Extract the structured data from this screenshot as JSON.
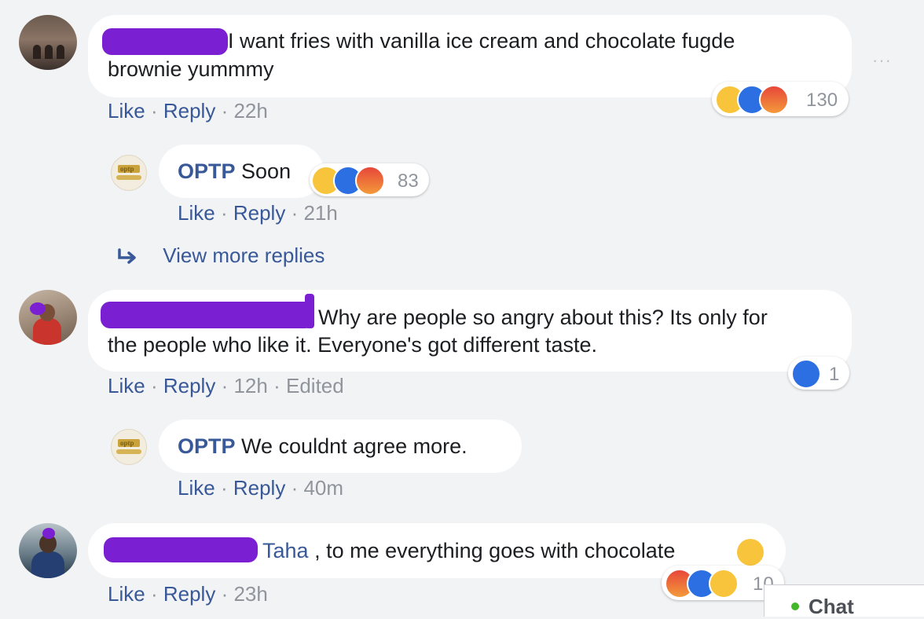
{
  "comments": [
    {
      "text": "I want fries with vanilla ice cream and chocolate fugde",
      "text2": "brownie yummmy",
      "actions": {
        "like": "Like",
        "reply": "Reply",
        "time": "22h"
      },
      "reactions": {
        "icons": [
          "haha-icon",
          "like-icon",
          "angry-icon"
        ],
        "count": "130"
      }
    },
    {
      "text": "Why are people so angry about this? Its only for",
      "text2": "the people who like it. Everyone's got different taste.",
      "actions": {
        "like": "Like",
        "reply": "Reply",
        "time": "12h",
        "edited": "Edited"
      },
      "reactions": {
        "icons": [
          "like-icon"
        ],
        "count": "1"
      }
    },
    {
      "mention": "Taha",
      "text": ", to me everything goes with chocolate",
      "actions": {
        "like": "Like",
        "reply": "Reply",
        "time": "23h"
      },
      "reactions": {
        "icons": [
          "angry-icon",
          "like-icon",
          "haha-icon"
        ],
        "count": "10"
      }
    }
  ],
  "replies": [
    {
      "author": "OPTP",
      "text": "Soon",
      "actions": {
        "like": "Like",
        "reply": "Reply",
        "time": "21h"
      },
      "reactions": {
        "icons": [
          "haha-icon",
          "like-icon",
          "angry-icon"
        ],
        "count": "83"
      }
    },
    {
      "author": "OPTP",
      "text": "We couldnt agree more.",
      "actions": {
        "like": "Like",
        "reply": "Reply",
        "time": "40m"
      }
    }
  ],
  "view_more": "View more replies",
  "more_options": "···",
  "chat_label": "Chat",
  "avatar_logo_text": "optp",
  "separator": "·",
  "colors": {
    "link": "#385898",
    "meta_gray": "#90949c",
    "redaction": "#7a1fd1",
    "bubble": "#ffffff",
    "page_bg": "#f2f3f5",
    "like_blue": "#2b6fe3",
    "haha_yellow": "#f7c43b"
  }
}
